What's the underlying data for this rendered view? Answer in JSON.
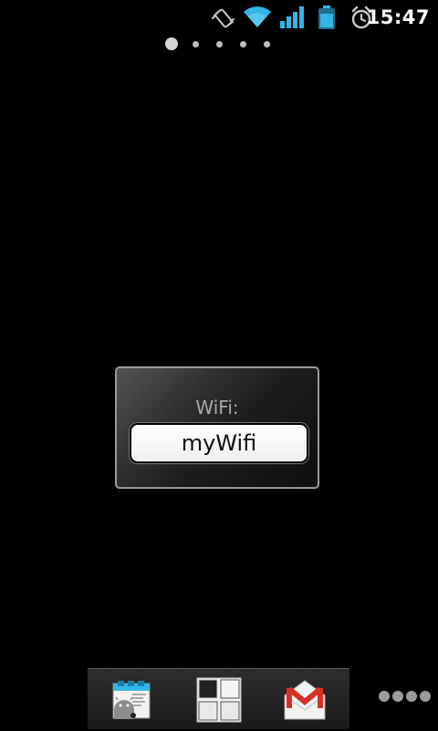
{
  "status_bar": {
    "time": "15:47",
    "icons": [
      "vibrate-icon",
      "wifi-icon",
      "signal-icon",
      "battery-icon",
      "alarm-icon"
    ],
    "accent_color": "#33b5e5"
  },
  "home": {
    "page_count": 5,
    "active_page": 1
  },
  "widget": {
    "label": "WiFi:",
    "value": "myWifi"
  },
  "dock": {
    "apps": [
      {
        "icon": "android-app-icon"
      },
      {
        "icon": "app-drawer-icon"
      },
      {
        "icon": "gmail-icon"
      }
    ]
  }
}
